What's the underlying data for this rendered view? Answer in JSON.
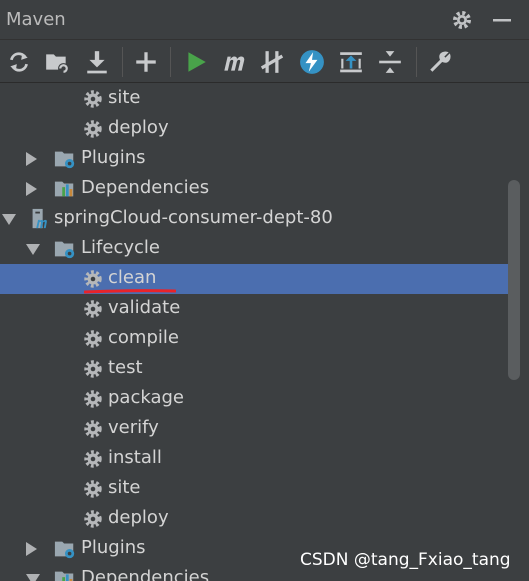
{
  "window": {
    "title": "Maven",
    "settings_icon": "gear-icon",
    "minimize_icon": "minimize-icon"
  },
  "toolbar": {
    "icons": [
      "reload-all-icon",
      "generate-sources-icon",
      "download-icon",
      "add-icon",
      "run-icon",
      "execute-goal-icon",
      "toggle-offline-icon",
      "skip-tests-icon",
      "show-dependencies-icon",
      "collapse-all-icon",
      "settings-wrench-icon"
    ]
  },
  "tree": {
    "rows": [
      {
        "label": "site",
        "type": "goal"
      },
      {
        "label": "deploy",
        "type": "goal"
      },
      {
        "label": "Plugins",
        "type": "folder"
      },
      {
        "label": "Dependencies",
        "type": "deps"
      },
      {
        "label": "springCloud-consumer-dept-80",
        "type": "project"
      },
      {
        "label": "Lifecycle",
        "type": "folder"
      },
      {
        "label": "clean",
        "type": "goal",
        "selected": true
      },
      {
        "label": "validate",
        "type": "goal"
      },
      {
        "label": "compile",
        "type": "goal"
      },
      {
        "label": "test",
        "type": "goal"
      },
      {
        "label": "package",
        "type": "goal"
      },
      {
        "label": "verify",
        "type": "goal"
      },
      {
        "label": "install",
        "type": "goal"
      },
      {
        "label": "site",
        "type": "goal"
      },
      {
        "label": "deploy",
        "type": "goal"
      },
      {
        "label": "Plugins",
        "type": "folder"
      },
      {
        "label": "Dependencies",
        "type": "deps"
      }
    ]
  },
  "colors": {
    "background": "#3c3f41",
    "selection": "#4b6eaf",
    "annotation_underline": "#e8232a"
  },
  "watermark": "CSDN @tang_Fxiao_tang"
}
